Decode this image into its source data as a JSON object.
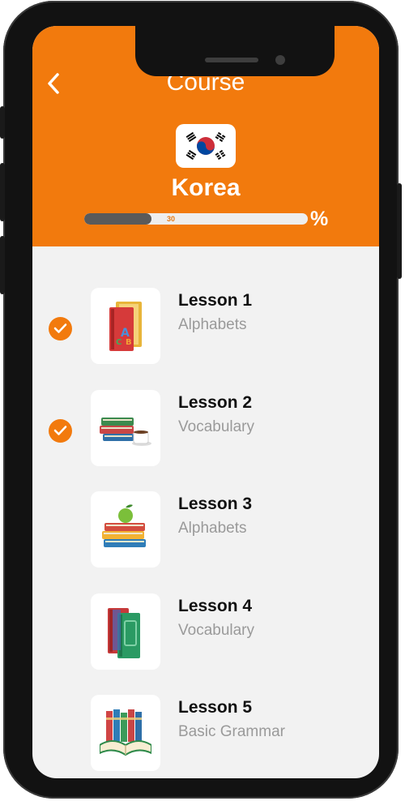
{
  "header": {
    "back_icon": "chevron-left-icon",
    "title": "Course",
    "country": "Korea",
    "flag_icon": "south-korea-flag-icon",
    "accent_color": "#f27a0d"
  },
  "progress": {
    "value": 30,
    "label": "30",
    "unit": "%"
  },
  "lessons": [
    {
      "title": "Lesson 1",
      "subtitle": "Alphabets",
      "completed": true,
      "icon": "alphabet-book-icon"
    },
    {
      "title": "Lesson 2",
      "subtitle": "Vocabulary",
      "completed": true,
      "icon": "books-and-coffee-icon"
    },
    {
      "title": "Lesson 3",
      "subtitle": "Alphabets",
      "completed": false,
      "icon": "books-with-apple-icon"
    },
    {
      "title": "Lesson 4",
      "subtitle": "Vocabulary",
      "completed": false,
      "icon": "standing-books-icon"
    },
    {
      "title": "Lesson 5",
      "subtitle": "Basic Grammar",
      "completed": false,
      "icon": "open-book-library-icon"
    }
  ]
}
